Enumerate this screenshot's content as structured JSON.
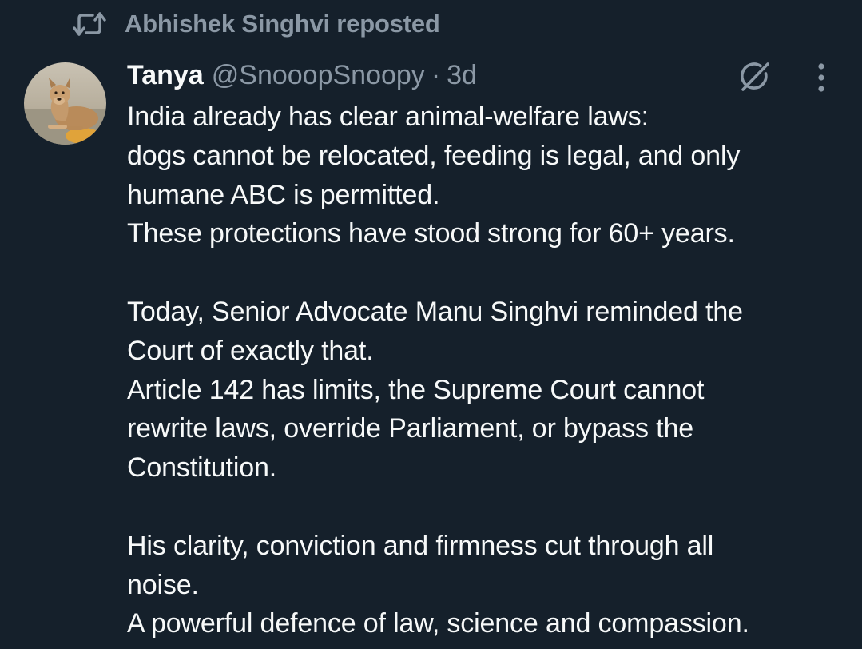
{
  "repost": {
    "text": "Abhishek Singhvi reposted",
    "icon": "repost-icon"
  },
  "author": {
    "name": "Tanya",
    "handle": "@SnooopSnoopy",
    "separator": "·",
    "time": "3d",
    "avatar_icon": "dog-avatar"
  },
  "actions": {
    "grok_icon": "grok-icon",
    "more_icon": "more-icon"
  },
  "tweet": {
    "lines": [
      "India already has clear animal-welfare laws:",
      "dogs cannot be relocated, feeding is legal, and only",
      "humane ABC is permitted.",
      "These protections have stood strong for 60+ years.",
      "",
      "Today, Senior Advocate Manu Singhvi reminded the",
      "Court of exactly that.",
      "Article 142 has limits, the Supreme Court cannot",
      "rewrite laws, override Parliament, or bypass the",
      "Constitution.",
      "",
      "His clarity, conviction and firmness cut through all",
      "noise.",
      "A powerful defence of law, science and compassion."
    ]
  },
  "colors": {
    "background": "#15202b",
    "primary_text": "#f7f9f9",
    "secondary_text": "#8b98a5"
  }
}
